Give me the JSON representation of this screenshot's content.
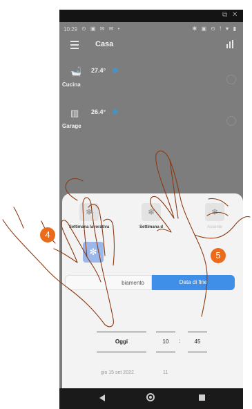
{
  "status_bar": {
    "time": "10:29",
    "left_icons": "⊙ ▣ ✉ ✉ •",
    "right_icons": "✱ ▣ ⊙ ! ♥ ▮"
  },
  "window_icons": {
    "restore": "⧉",
    "close": "✕"
  },
  "app": {
    "title": "Casa"
  },
  "rooms": [
    {
      "icon": "🛁",
      "temp": "27.4°",
      "mode_icon": "❄",
      "name": "Cucina"
    },
    {
      "icon": "▥",
      "temp": "26.4°",
      "mode_icon": "❄",
      "name": "Garage"
    }
  ],
  "programs": [
    {
      "icon": "❄",
      "label": "Settimana lavorativa"
    },
    {
      "icon": "❄",
      "label": "Settimana d"
    },
    {
      "icon": "❄",
      "label": "Assente"
    }
  ],
  "custom_tile_icon": "✻",
  "segment": {
    "left_label": "biamento",
    "right_label": "Data di fine"
  },
  "picker": {
    "day": "Oggi",
    "hour": "10",
    "minute": "45",
    "separator": ":"
  },
  "next_row": {
    "day": "gio 15 set 2022",
    "hour": "11"
  },
  "badges": {
    "step4": "4",
    "step5": "5"
  },
  "colors": {
    "accent": "#3f8fe8",
    "badge": "#ea6b1b",
    "snow": "#2f9ee8"
  }
}
